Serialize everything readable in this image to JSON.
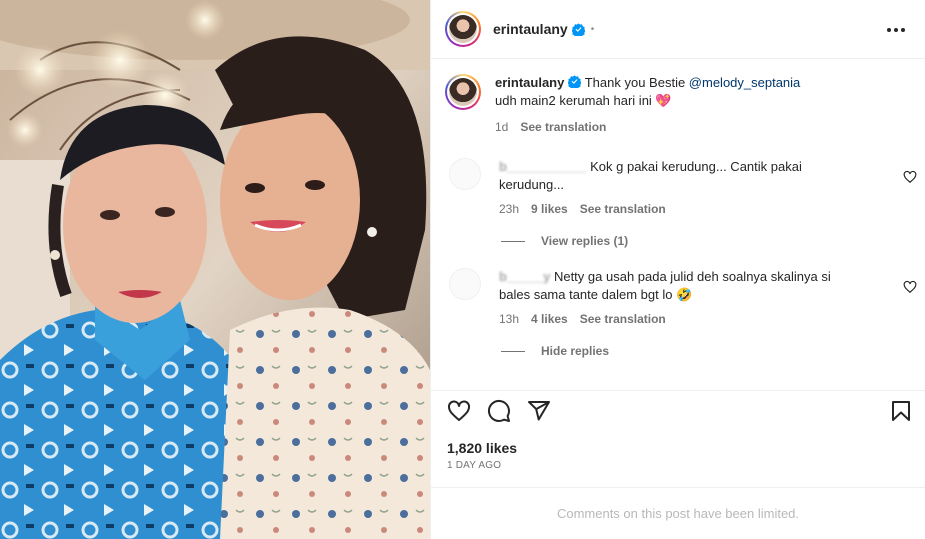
{
  "post": {
    "username": "erintaulany",
    "dot": "•",
    "likes": "1,820 likes",
    "time_ago": "1 DAY AGO",
    "limited_notice": "Comments on this post have been limited."
  },
  "caption": {
    "username": "erintaulany",
    "text_before": " Thank you Bestie ",
    "mention": "@melody_septania",
    "text_after": " udh main2 kerumah hari ini ",
    "emoji": "💖",
    "time": "1d",
    "see_translation": "See translation"
  },
  "comments": [
    {
      "user": "b___________",
      "text": "Kok g pakai kerudung... Cantik pakai kerudung...",
      "time": "23h",
      "likes": "9 likes",
      "see_translation": "See translation",
      "replies_toggle": "View replies (1)"
    },
    {
      "user": "b_____y",
      "text": "Netty ga usah pada julid deh soalnya skalinya si bales sama tante dalem bgt lo ",
      "emoji": "🤣",
      "time": "13h",
      "likes": "4 likes",
      "see_translation": "See translation",
      "replies_toggle": "Hide replies"
    }
  ],
  "icons": {
    "verified": "verified-badge-icon",
    "more": "more-options-icon",
    "like": "heart-icon",
    "comment": "comment-icon",
    "share": "share-icon",
    "save": "bookmark-icon"
  },
  "colors": {
    "verified": "#0095f6",
    "link": "#00376b",
    "muted": "#737373"
  }
}
